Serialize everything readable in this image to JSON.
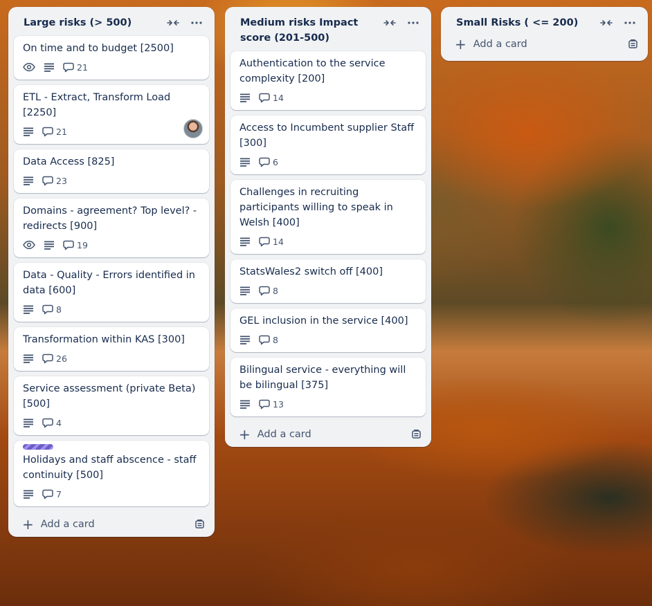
{
  "lists": [
    {
      "title": "Large risks (> 500)",
      "add_card_label": "Add a card",
      "cards": [
        {
          "title": "On time and to budget [2500]",
          "watch": true,
          "description": true,
          "comments": "21",
          "avatar": false,
          "label": false
        },
        {
          "title": "ETL - Extract, Transform Load [2250]",
          "watch": false,
          "description": true,
          "comments": "21",
          "avatar": true,
          "label": false
        },
        {
          "title": "Data Access [825]",
          "watch": false,
          "description": true,
          "comments": "23",
          "avatar": false,
          "label": false
        },
        {
          "title": "Domains - agreement? Top level? - redirects [900]",
          "watch": true,
          "description": true,
          "comments": "19",
          "avatar": false,
          "label": false
        },
        {
          "title": "Data - Quality - Errors identified in data [600]",
          "watch": false,
          "description": true,
          "comments": "8",
          "avatar": false,
          "label": false
        },
        {
          "title": "Transformation within KAS [300]",
          "watch": false,
          "description": true,
          "comments": "26",
          "avatar": false,
          "label": false
        },
        {
          "title": "Service assessment (private Beta) [500]",
          "watch": false,
          "description": true,
          "comments": "4",
          "avatar": false,
          "label": false
        },
        {
          "title": "Holidays and staff abscence - staff continuity [500]",
          "watch": false,
          "description": true,
          "comments": "7",
          "avatar": false,
          "label": true
        }
      ]
    },
    {
      "title": "Medium risks Impact score (201-500)",
      "add_card_label": "Add a card",
      "cards": [
        {
          "title": "Authentication to the service complexity [200]",
          "watch": false,
          "description": true,
          "comments": "14",
          "avatar": false,
          "label": false
        },
        {
          "title": "Access to Incumbent supplier Staff [300]",
          "watch": false,
          "description": true,
          "comments": "6",
          "avatar": false,
          "label": false
        },
        {
          "title": "Challenges in recruiting participants willing to speak in Welsh [400]",
          "watch": false,
          "description": true,
          "comments": "14",
          "avatar": false,
          "label": false
        },
        {
          "title": "StatsWales2 switch off [400]",
          "watch": false,
          "description": true,
          "comments": "8",
          "avatar": false,
          "label": false
        },
        {
          "title": "GEL inclusion in the service [400]",
          "watch": false,
          "description": true,
          "comments": "8",
          "avatar": false,
          "label": false
        },
        {
          "title": "Bilingual service - everything will be bilingual [375]",
          "watch": false,
          "description": true,
          "comments": "13",
          "avatar": false,
          "label": false
        }
      ]
    },
    {
      "title": "Small Risks ( <= 200)",
      "add_card_label": "Add a card",
      "cards": []
    }
  ],
  "icons": {
    "collapse": "collapse-list-icon",
    "more": "more-actions-icon",
    "watch": "eye-icon",
    "description": "description-icon",
    "comments": "comment-icon",
    "add": "plus-icon",
    "template": "card-template-icon"
  },
  "colors": {
    "list_bg": "#f1f2f4",
    "card_bg": "#ffffff",
    "text": "#172b4d",
    "subtle_text": "#44546f",
    "label_purple": "#6e5dc6"
  }
}
